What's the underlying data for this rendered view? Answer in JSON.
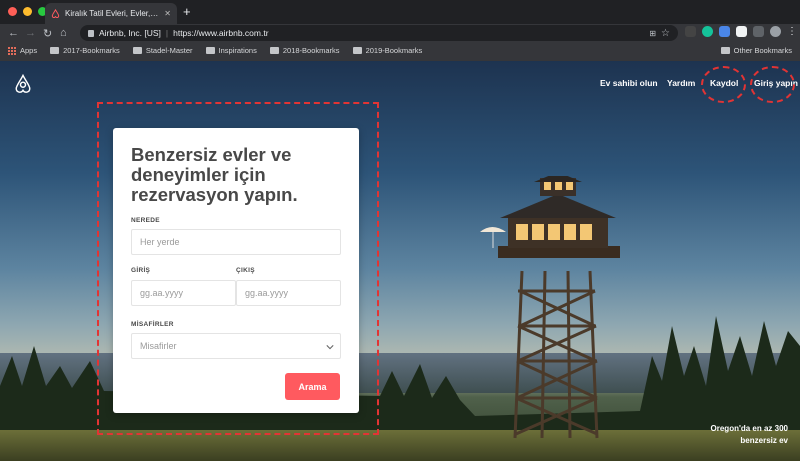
{
  "browser": {
    "tab_title": "Kiralık Tatil Evleri, Evler, Deneyim",
    "new_tab_label": "+",
    "site_identity": "Airbnb, Inc. [US]",
    "url": "https://www.airbnb.com.tr",
    "bookmarks": [
      "Apps",
      "2017-Bookmarks",
      "Stadel-Master",
      "Inspirations",
      "2018-Bookmarks",
      "2019-Bookmarks"
    ],
    "other_bookmarks": "Other Bookmarks",
    "traffic_light_colors": [
      "#ff5f57",
      "#febc2e",
      "#28c840"
    ]
  },
  "site": {
    "nav": {
      "host": "Ev sahibi olun",
      "help": "Yardım",
      "signup": "Kaydol",
      "login": "Giriş yapın"
    },
    "brand_color": "#ff5a5f",
    "annotation_color": "#e23434"
  },
  "search": {
    "heading": "Benzersiz evler ve deneyimler için rezervasyon yapın.",
    "where_label": "NEREDE",
    "where_placeholder": "Her yerde",
    "checkin_label": "GİRİŞ",
    "checkin_placeholder": "gg.aa.yyyy",
    "checkout_label": "ÇIKIŞ",
    "checkout_placeholder": "gg.aa.yyyy",
    "guests_label": "MİSAFİRLER",
    "guests_value": "Misafirler",
    "submit_label": "Arama"
  },
  "hero": {
    "caption": "Oregon'da en az 300 benzersiz ev"
  }
}
